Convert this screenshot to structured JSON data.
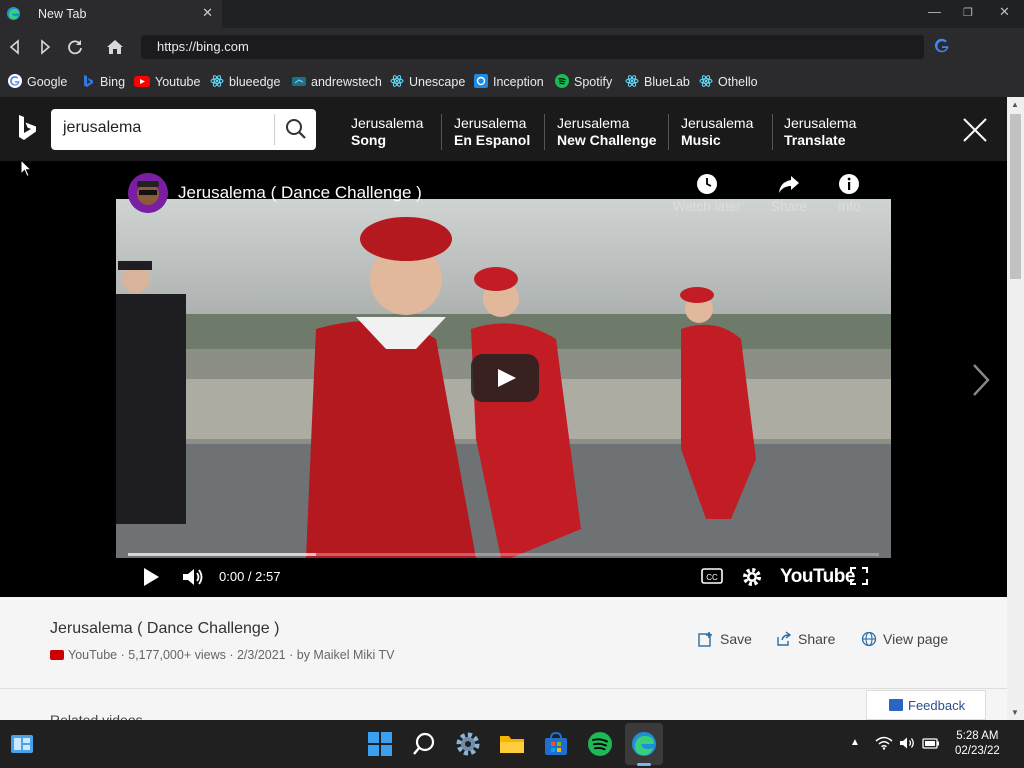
{
  "browser": {
    "tab_title": "New Tab",
    "tab_close": "✕",
    "url": "https://bing.com",
    "window_controls": {
      "minimize": "—",
      "maximize": "❐",
      "close": "✕"
    }
  },
  "bookmarks": [
    {
      "label": "Google",
      "icon": "google-icon",
      "color": "#ffffff"
    },
    {
      "label": "Bing",
      "icon": "bing-icon",
      "color": "#2f7be6"
    },
    {
      "label": "Youtube",
      "icon": "youtube-icon",
      "color": "#ff0000"
    },
    {
      "label": "blueedge",
      "icon": "react-icon",
      "color": "#61dafb"
    },
    {
      "label": "andrewstech",
      "icon": "andrewstech-icon",
      "color": "#1f6f8b"
    },
    {
      "label": "Unescape",
      "icon": "react-icon",
      "color": "#61dafb"
    },
    {
      "label": "Inception",
      "icon": "inception-icon",
      "color": "#1e88e5"
    },
    {
      "label": "Spotify",
      "icon": "spotify-icon",
      "color": "#1db954"
    },
    {
      "label": "BlueLab",
      "icon": "react-icon",
      "color": "#61dafb"
    },
    {
      "label": "Othello",
      "icon": "react-icon",
      "color": "#61dafb"
    }
  ],
  "search": {
    "query": "jerusalema",
    "related": [
      {
        "prefix": "Jerusalema",
        "term": "Song"
      },
      {
        "prefix": "Jerusalema",
        "term": "En Espanol"
      },
      {
        "prefix": "Jerusalema",
        "term": "New Challenge"
      },
      {
        "prefix": "Jerusalema",
        "term": "Music"
      },
      {
        "prefix": "Jerusalema",
        "term": "Translate"
      }
    ]
  },
  "video": {
    "title": "Jerusalema ( Dance Challenge )",
    "actions": {
      "watch_later": "Watch later",
      "share": "Share",
      "info": "Info"
    },
    "time": "0:00 / 2:57",
    "progress": 0.25,
    "player_logo": "YouTube"
  },
  "details": {
    "title": "Jerusalema ( Dance Challenge )",
    "meta": "YouTube · 5,177,000+ views · 2/3/2021 · by Maikel Miki TV",
    "save": "Save",
    "share": "Share",
    "view_page": "View page",
    "related_heading": "Related videos",
    "feedback": "Feedback"
  },
  "taskbar": {
    "time": "5:28 AM",
    "date": "02/23/22",
    "accent": "#7ab8f5"
  }
}
